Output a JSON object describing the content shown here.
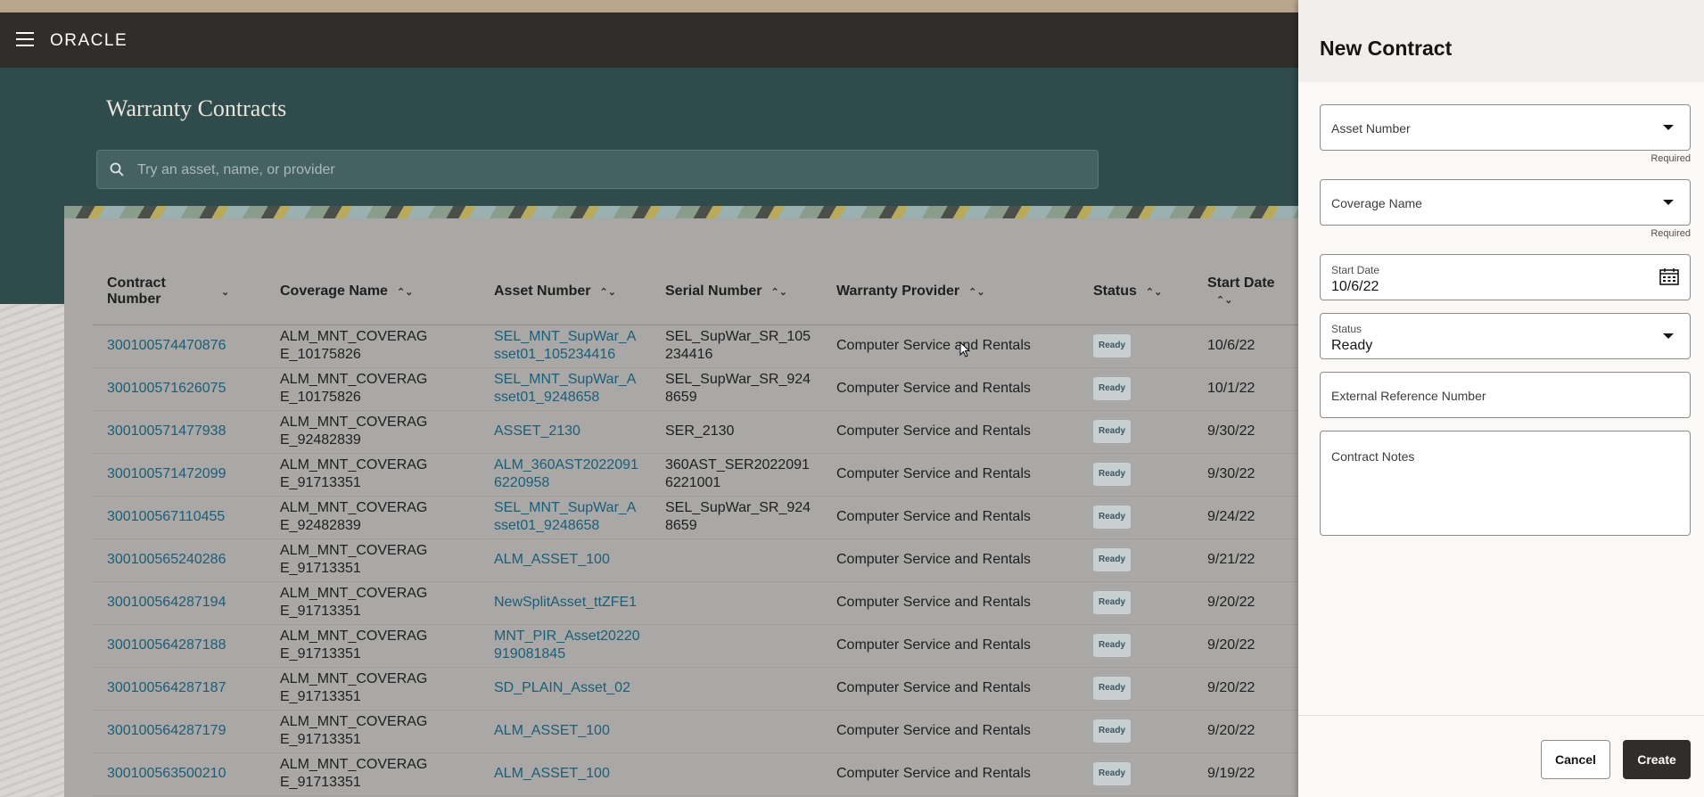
{
  "header": {
    "logo": "ORACLE"
  },
  "page": {
    "title": "Warranty Contracts",
    "search_placeholder": "Try an asset, name, or provider"
  },
  "table": {
    "columns": [
      "Contract Number",
      "Coverage Name",
      "Asset Number",
      "Serial Number",
      "Warranty Provider",
      "Status",
      "Start Date"
    ],
    "rows": [
      {
        "contract": "300100574470876",
        "coverage": "ALM_MNT_COVERAGE_10175826",
        "asset": "SEL_MNT_SupWar_Asset01_105234416",
        "serial": "SEL_SupWar_SR_105234416",
        "provider": "Computer Service and Rentals",
        "status": "Ready",
        "start": "10/6/22"
      },
      {
        "contract": "300100571626075",
        "coverage": "ALM_MNT_COVERAGE_10175826",
        "asset": "SEL_MNT_SupWar_Asset01_9248658",
        "serial": "SEL_SupWar_SR_9248659",
        "provider": "Computer Service and Rentals",
        "status": "Ready",
        "start": "10/1/22"
      },
      {
        "contract": "300100571477938",
        "coverage": "ALM_MNT_COVERAGE_92482839",
        "asset": "ASSET_2130",
        "serial": "SER_2130",
        "provider": "Computer Service and Rentals",
        "status": "Ready",
        "start": "9/30/22"
      },
      {
        "contract": "300100571472099",
        "coverage": "ALM_MNT_COVERAGE_91713351",
        "asset": "ALM_360AST20220916220958",
        "serial": "360AST_SER20220916221001",
        "provider": "Computer Service and Rentals",
        "status": "Ready",
        "start": "9/30/22"
      },
      {
        "contract": "300100567110455",
        "coverage": "ALM_MNT_COVERAGE_92482839",
        "asset": "SEL_MNT_SupWar_Asset01_9248658",
        "serial": "SEL_SupWar_SR_9248659",
        "provider": "Computer Service and Rentals",
        "status": "Ready",
        "start": "9/24/22"
      },
      {
        "contract": "300100565240286",
        "coverage": "ALM_MNT_COVERAGE_91713351",
        "asset": "ALM_ASSET_100",
        "serial": "",
        "provider": "Computer Service and Rentals",
        "status": "Ready",
        "start": "9/21/22"
      },
      {
        "contract": "300100564287194",
        "coverage": "ALM_MNT_COVERAGE_91713351",
        "asset": "NewSplitAsset_ttZFE1",
        "serial": "",
        "provider": "Computer Service and Rentals",
        "status": "Ready",
        "start": "9/20/22"
      },
      {
        "contract": "300100564287188",
        "coverage": "ALM_MNT_COVERAGE_91713351",
        "asset": "MNT_PIR_Asset20220919081845",
        "serial": "",
        "provider": "Computer Service and Rentals",
        "status": "Ready",
        "start": "9/20/22"
      },
      {
        "contract": "300100564287187",
        "coverage": "ALM_MNT_COVERAGE_91713351",
        "asset": "SD_PLAIN_Asset_02",
        "serial": "",
        "provider": "Computer Service and Rentals",
        "status": "Ready",
        "start": "9/20/22"
      },
      {
        "contract": "300100564287179",
        "coverage": "ALM_MNT_COVERAGE_91713351",
        "asset": "ALM_ASSET_100",
        "serial": "",
        "provider": "Computer Service and Rentals",
        "status": "Ready",
        "start": "9/20/22"
      },
      {
        "contract": "300100563500210",
        "coverage": "ALM_MNT_COVERAGE_91713351",
        "asset": "ALM_ASSET_100",
        "serial": "",
        "provider": "Computer Service and Rentals",
        "status": "Ready",
        "start": "9/19/22"
      }
    ]
  },
  "drawer": {
    "title": "New Contract",
    "asset_number": {
      "label": "Asset Number",
      "hint": "Required"
    },
    "coverage_name": {
      "label": "Coverage Name",
      "hint": "Required"
    },
    "start_date": {
      "label": "Start Date",
      "value": "10/6/22"
    },
    "status": {
      "label": "Status",
      "value": "Ready"
    },
    "external_ref": {
      "label": "External Reference Number"
    },
    "notes": {
      "label": "Contract Notes"
    },
    "cancel_label": "Cancel",
    "create_label": "Create"
  }
}
